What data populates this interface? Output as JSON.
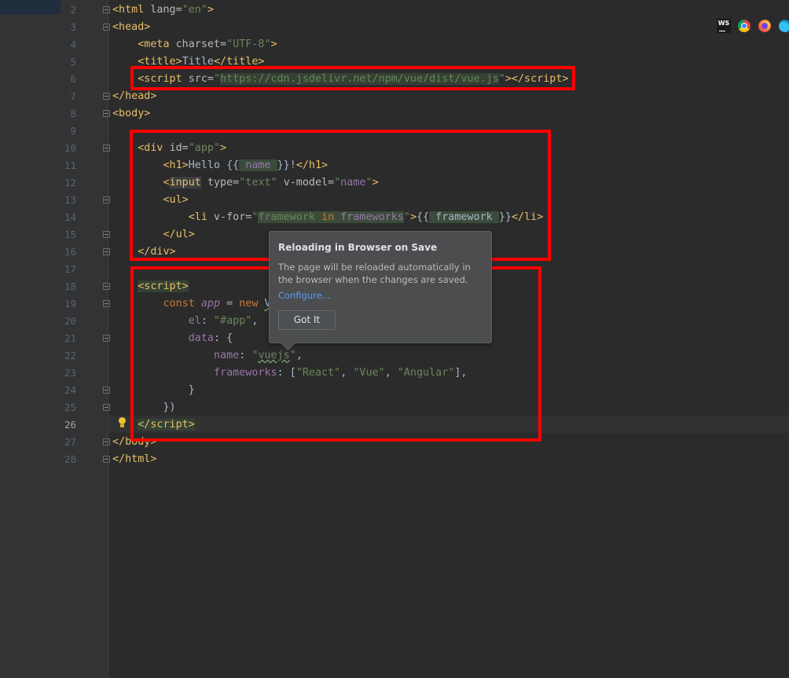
{
  "editor": {
    "current_line": 26,
    "lines": [
      {
        "num": "2",
        "html": "<span class=\"t\">&lt;html </span><span class=\"a\">lang=</span><span class=\"s\">\"en\"</span><span class=\"t\">&gt;</span>"
      },
      {
        "num": "3",
        "html": "<span class=\"t\">&lt;head&gt;</span>"
      },
      {
        "num": "4",
        "html": "    <span class=\"t\">&lt;meta </span><span class=\"a\">charset=</span><span class=\"s\">\"UTF-8\"</span><span class=\"t\">&gt;</span>"
      },
      {
        "num": "5",
        "html": "    <span class=\"t\">&lt;title&gt;</span>Title<span class=\"t\">&lt;/title&gt;</span>"
      },
      {
        "num": "6",
        "html": "    <span class=\"t\">&lt;script </span><span class=\"a\">src=</span><span class=\"s\">\"<span class=\"hl\">https://cdn.jsdelivr.net/npm/vue/dist/vue.js</span>\"</span><span class=\"t\">&gt;&lt;/script&gt;</span>"
      },
      {
        "num": "7",
        "html": "<span class=\"t\">&lt;/head&gt;</span>"
      },
      {
        "num": "8",
        "html": "<span class=\"t\">&lt;body&gt;</span>"
      },
      {
        "num": "9",
        "html": ""
      },
      {
        "num": "10",
        "html": "    <span class=\"t\">&lt;div </span><span class=\"a\">id=</span><span class=\"s\">\"app\"</span><span class=\"t\">&gt;</span>"
      },
      {
        "num": "11",
        "html": "        <span class=\"t\">&lt;h1&gt;</span>Hello {{<span class=\"hl2\"> <span class=\"p\">name</span> </span>}}!<span class=\"t\">&lt;/h1&gt;</span>"
      },
      {
        "num": "12",
        "html": "        <span class=\"t\">&lt;<span class=\"mhl\">input</span> </span><span class=\"a\">type=</span><span class=\"s\">\"text\"</span> <span class=\"a\">v-model=</span><span class=\"s\">\"<span class=\"p\">name</span>\"</span><span class=\"t\">&gt;</span>"
      },
      {
        "num": "13",
        "html": "        <span class=\"t\">&lt;ul&gt;</span>"
      },
      {
        "num": "14",
        "html": "            <span class=\"t\">&lt;li </span><span class=\"a\">v-for=</span><span class=\"s\">\"<span class=\"hl2\">framework <span class=\"k\">in</span> <span class=\"p\">frameworks</span></span>\"</span><span class=\"t\">&gt;</span>{{<span class=\"hl2\"> framework </span>}}<span class=\"t\">&lt;/li&gt;</span>"
      },
      {
        "num": "15",
        "html": "        <span class=\"t\">&lt;/ul&gt;</span>"
      },
      {
        "num": "16",
        "html": "    <span class=\"t\">&lt;/div&gt;</span>"
      },
      {
        "num": "17",
        "html": ""
      },
      {
        "num": "18",
        "html": "    <span class=\"t hl\">&lt;script&gt;</span>"
      },
      {
        "num": "19",
        "html": "        <span class=\"k\">const </span><span class=\"i\">app</span> = <span class=\"k\">new </span><span class=\"ulw\">V</span>"
      },
      {
        "num": "20",
        "html": "            <span class=\"p\">el</span>: <span class=\"s\">\"#app\"</span>,"
      },
      {
        "num": "21",
        "html": "            <span class=\"p\">data</span>: {"
      },
      {
        "num": "22",
        "html": "                <span class=\"p\">name</span>: <span class=\"s\">\"<span class=\"ulw\">vuejs</span>\"</span>,"
      },
      {
        "num": "23",
        "html": "                <span class=\"p\">frameworks</span>: [<span class=\"s\">\"React\"</span>, <span class=\"s\">\"Vue\"</span>, <span class=\"s\">\"Angular\"</span>],"
      },
      {
        "num": "24",
        "html": "            }"
      },
      {
        "num": "25",
        "html": "        })"
      },
      {
        "num": "26",
        "html": "    <span class=\"t hl\">&lt;/script&gt;</span>"
      },
      {
        "num": "27",
        "html": "<span class=\"t\">&lt;/body&gt;</span>"
      },
      {
        "num": "28",
        "html": "<span class=\"t\">&lt;/html&gt;</span>"
      }
    ],
    "fold_lines": [
      2,
      3,
      7,
      8,
      10,
      13,
      15,
      16,
      18,
      19,
      21,
      24,
      25,
      27,
      28
    ]
  },
  "tooltip": {
    "title": "Reloading in Browser on Save",
    "body": "The page will be reloaded automatically in the browser when the changes are saved.",
    "link": "Configure...",
    "button": "Got It"
  },
  "browser_icons": [
    "webstorm-icon",
    "chrome-icon",
    "firefox-icon",
    "edge-icon"
  ],
  "ws_icon_text": "WS",
  "highlight_color": "#ff0000"
}
